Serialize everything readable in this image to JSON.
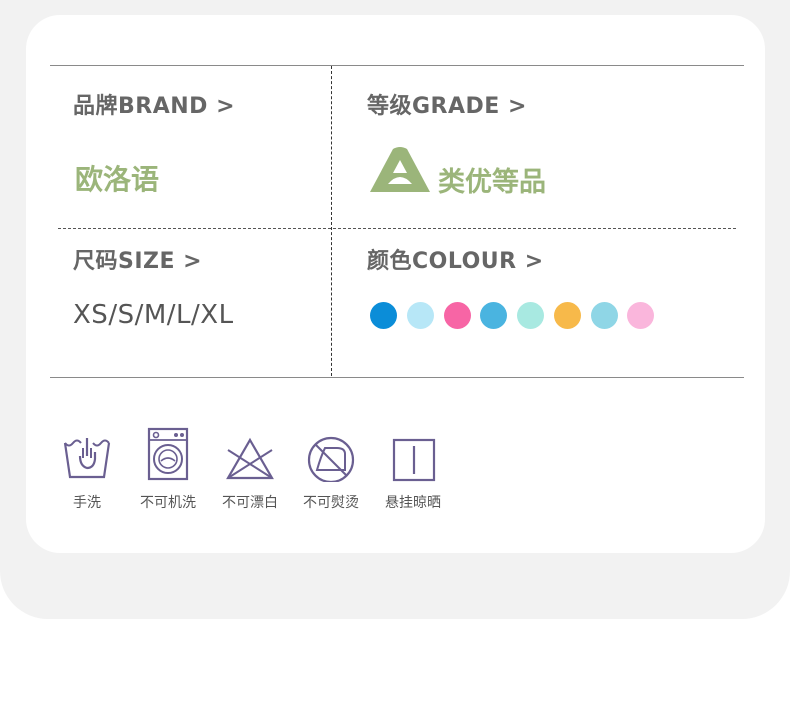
{
  "brand": {
    "label": "品牌BRAND >",
    "value": "欧洛语"
  },
  "grade": {
    "label": "等级GRADE >",
    "letter": "A",
    "value": "类优等品"
  },
  "size": {
    "label": "尺码SIZE >",
    "value": "XS/S/M/L/XL"
  },
  "colour": {
    "label": "颜色COLOUR >",
    "swatches": [
      "#0b8dd8",
      "#b7e7f7",
      "#f765a5",
      "#4ab4e0",
      "#a8e9e1",
      "#f7b94a",
      "#8fd6e6",
      "#fab6dc"
    ]
  },
  "care": [
    {
      "icon": "hand-wash-icon",
      "label": "手洗"
    },
    {
      "icon": "no-machine-wash-icon",
      "label": "不可机洗"
    },
    {
      "icon": "no-bleach-icon",
      "label": "不可漂白"
    },
    {
      "icon": "no-iron-icon",
      "label": "不可熨烫"
    },
    {
      "icon": "hang-dry-icon",
      "label": "悬挂晾晒"
    }
  ],
  "colors": {
    "accent_green": "#9bb57a",
    "label_gray": "#666666",
    "icon_purple": "#6a5f91"
  }
}
